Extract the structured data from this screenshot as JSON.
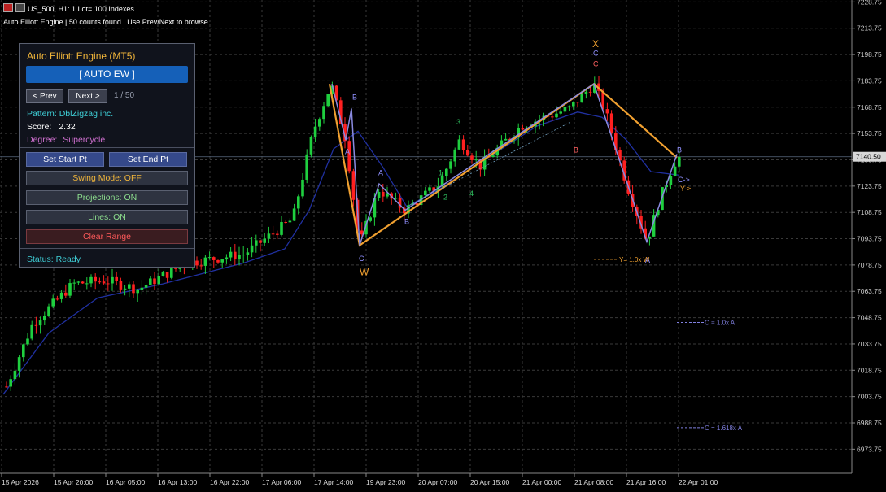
{
  "header": {
    "symbol_line": "US_500, H1:  1 Lot= 100 Indexes",
    "info_line": "Auto Elliott Engine | 50 counts found | Use Prev/Next to browse"
  },
  "panel": {
    "title": "Auto Elliott Engine (MT5)",
    "mode_button": "[ AUTO EW ]",
    "prev_button": "< Prev",
    "next_button": "Next >",
    "count": "1  /  50",
    "pattern_label": "Pattern: DblZigzag inc.",
    "score_label": "Score:",
    "score_value": "2.32",
    "degree_label": "Degree:",
    "degree_value": "Supercycle",
    "set_start_button": "Set Start Pt",
    "set_end_button": "Set End Pt",
    "swing_mode_button": "Swing Mode: OFF",
    "projections_button": "Projections: ON",
    "lines_button": "Lines: ON",
    "clear_button": "Clear Range",
    "status": "Status: Ready",
    "colors": {
      "accent": "#f2b63a",
      "blue": "#1560b8",
      "cyan": "#3fd0d8",
      "magenta": "#d070d0",
      "clear_red": "#ff5a5a"
    }
  },
  "chart_data": {
    "type": "candlestick",
    "symbol": "US_500",
    "timeframe": "H1",
    "current_price": "7140.50",
    "ylim": [
      6960,
      7228
    ],
    "y_ticks": [
      "7228.75",
      "7213.75",
      "7198.75",
      "7183.75",
      "7168.75",
      "7153.75",
      "7138.75",
      "7123.75",
      "7108.75",
      "7093.75",
      "7078.75",
      "7063.75",
      "7048.75",
      "7033.75",
      "7018.75",
      "7003.75",
      "6988.75",
      "6973.75"
    ],
    "x_ticks": [
      "15 Apr 2026",
      "15 Apr 20:00",
      "16 Apr 05:00",
      "16 Apr 13:00",
      "16 Apr 22:00",
      "17 Apr 06:00",
      "17 Apr 14:00",
      "19 Apr 23:00",
      "20 Apr 07:00",
      "20 Apr 15:00",
      "21 Apr 00:00",
      "21 Apr 08:00",
      "21 Apr 16:00",
      "22 Apr 01:00"
    ],
    "wave_labels": [
      {
        "text": "B",
        "color": "#9090ff"
      },
      {
        "text": "A",
        "color": "#9090ff"
      },
      {
        "text": "A",
        "color": "#9090ff"
      },
      {
        "text": "B",
        "color": "#9090ff"
      },
      {
        "text": "C",
        "color": "#9090ff"
      },
      {
        "text": "W",
        "color": "#f0a030"
      },
      {
        "text": "1",
        "color": "#30c060"
      },
      {
        "text": "2",
        "color": "#30c060"
      },
      {
        "text": "3",
        "color": "#30c060"
      },
      {
        "text": "4",
        "color": "#30c060"
      },
      {
        "text": "X",
        "color": "#f0a030"
      },
      {
        "text": "C",
        "color": "#9090ff"
      },
      {
        "text": "C",
        "color": "#ff6060"
      },
      {
        "text": "B",
        "color": "#ff6060"
      },
      {
        "text": "A",
        "color": "#9090ff"
      },
      {
        "text": "B",
        "color": "#9090ff"
      },
      {
        "text": "C->",
        "color": "#9090ff"
      },
      {
        "text": "Y->",
        "color": "#f0a030"
      }
    ],
    "projections": [
      {
        "label": "Y= 1.0x W",
        "color": "#f0a030"
      },
      {
        "label": "C = 1.0x A",
        "color": "#8080e0"
      },
      {
        "label": "C = 1.618x A",
        "color": "#8080e0"
      }
    ]
  }
}
